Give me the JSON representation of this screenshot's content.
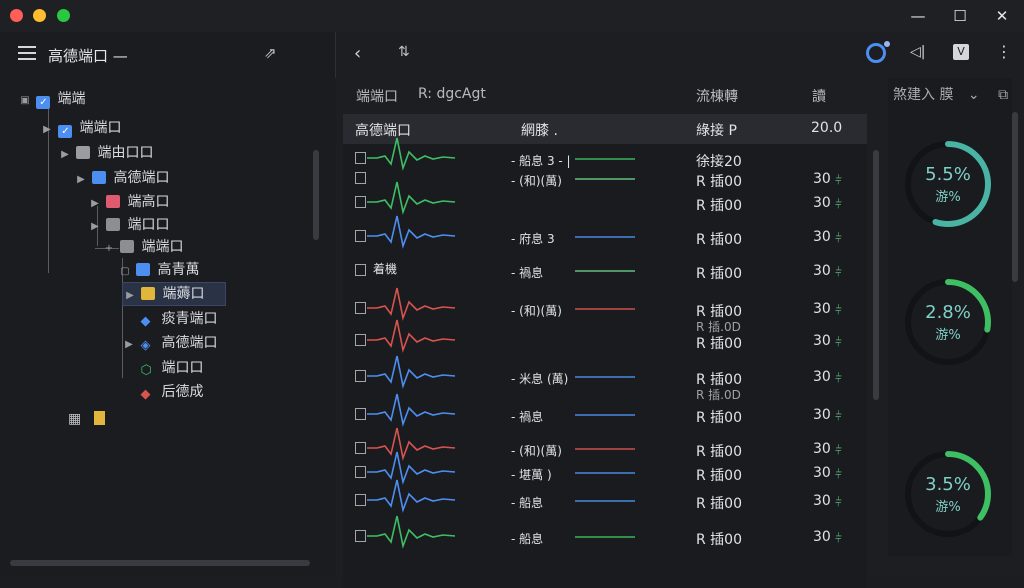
{
  "colors": {
    "close": "#ff5f57",
    "minimize": "#febc2e",
    "maximize": "#28c840",
    "accent_blue": "#4d8ff0",
    "teal": "#49b3a4",
    "green": "#3fbf63",
    "red": "#d9534f",
    "yellow": "#e2b63b"
  },
  "left": {
    "title": "高德端口 —",
    "tree": [
      {
        "label": "端端",
        "icon": "checkbox-checked",
        "color": "#4d8ff0"
      },
      {
        "label": "端端口",
        "icon": "checkbox-checked",
        "color": "#4d8ff0"
      },
      {
        "label": "端由口口",
        "icon": "file-icon",
        "color": "#9a9ca2"
      },
      {
        "label": "高德端口",
        "icon": "folder-icon",
        "color": "#4d8ff0"
      },
      {
        "label": "端高口",
        "icon": "folder-icon",
        "color": "#e05a70"
      },
      {
        "label": "端口口",
        "icon": "folder-icon",
        "color": "#8c8e94"
      },
      {
        "label": "端端口",
        "icon": "folder-icon",
        "color": "#8c8e94"
      },
      {
        "label": "高青萬",
        "icon": "folder-icon",
        "color": "#4d8ff0"
      },
      {
        "label": "端薅口",
        "icon": "folder-icon",
        "color": "#e2b63b"
      },
      {
        "label": "痰青端口",
        "icon": "diamond-icon",
        "color": "#4d8ff0"
      },
      {
        "label": "高德端口",
        "icon": "code-icon",
        "color": "#4d8ff0"
      },
      {
        "label": "端口口",
        "icon": "shield-icon",
        "color": "#3fbf63"
      },
      {
        "label": "后德成",
        "icon": "diamond-icon",
        "color": "#d9534f"
      }
    ]
  },
  "main": {
    "columns": {
      "name": "端端口",
      "sub": "R: dgcAgt",
      "flow": "流棟轉",
      "extra": "讀"
    },
    "selected_row": {
      "name": "高德端口",
      "type": "網膝 .",
      "status": "綠接 P",
      "num": "20.0"
    },
    "rows": [
      {
        "left_label": "",
        "wave_color": "#3fbf63",
        "mid": "- 船息 3 - |",
        "status": "徐接20",
        "num": "",
        "status2": "",
        "is_header_line": true
      },
      {
        "left_label": "",
        "wave_color": "",
        "mid": "- (和)(萬)",
        "status": "R 插00",
        "num": "30",
        "status2": ""
      },
      {
        "left_label": "",
        "wave_color": "#3fbf63",
        "mid": "",
        "status": "R 插00",
        "num": "30",
        "status2": ""
      },
      {
        "left_label": "",
        "wave_color": "#4d8ff0",
        "mid": "- 府息 3",
        "status": "R 插00",
        "num": "30",
        "status2": ""
      },
      {
        "left_label": "着機",
        "wave_color": "",
        "mid": "- 禍息",
        "status": "R 插00",
        "num": "30",
        "status2": ""
      },
      {
        "left_label": "",
        "wave_color": "#d9534f",
        "mid": "- (和)(萬)",
        "status": "R 插00",
        "num": "30",
        "status2": "R 插.0D"
      },
      {
        "left_label": "",
        "wave_color": "#d9534f",
        "mid": "",
        "status": "R 插00",
        "num": "30",
        "status2": ""
      },
      {
        "left_label": "",
        "wave_color": "#4d8ff0",
        "mid": "- 米息 (萬)",
        "status": "R 插00",
        "num": "30",
        "status2": "R 插.0D"
      },
      {
        "left_label": "",
        "wave_color": "#4d8ff0",
        "mid": "- 禍息",
        "status": "R 插00",
        "num": "30",
        "status2": ""
      },
      {
        "left_label": "",
        "wave_color": "#d9534f",
        "mid": "- (和)(萬)",
        "status": "R 插00",
        "num": "30",
        "status2": ""
      },
      {
        "left_label": "",
        "wave_color": "#4d8ff0",
        "mid": "- 堪萬 )",
        "status": "R 插00",
        "num": "30",
        "status2": ""
      },
      {
        "left_label": "",
        "wave_color": "#4d8ff0",
        "mid": "- 船息",
        "status": "R 插00",
        "num": "30",
        "status2": ""
      },
      {
        "left_label": "",
        "wave_color": "#3fbf63",
        "mid": "- 船息",
        "status": "R 插00",
        "num": "30",
        "status2": ""
      }
    ]
  },
  "right": {
    "header": "煞建入 膜",
    "gauges": [
      {
        "value": "5.5%",
        "sub": "游%",
        "fraction": 0.55
      },
      {
        "value": "2.8%",
        "sub": "游%",
        "fraction": 0.28
      },
      {
        "value": "3.5%",
        "sub": "游%",
        "fraction": 0.35
      }
    ]
  }
}
